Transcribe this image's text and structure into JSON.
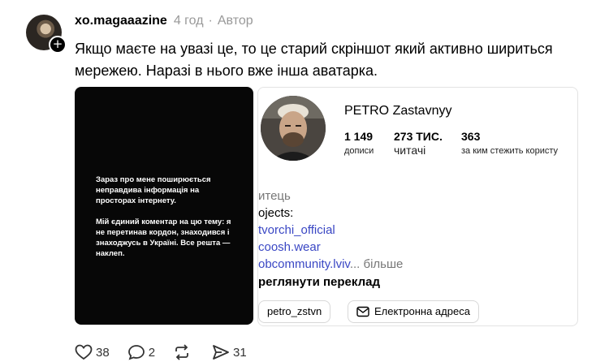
{
  "post": {
    "username": "xo.magaaazine",
    "time": "4 год",
    "role": "Автор",
    "separator": "·",
    "text": "Якщо маєте на увазі це, то це старий скріншот який активно шириться мережею. Наразі в нього вже інша аватарка."
  },
  "media_dark": {
    "paragraph_1": "Зараз про мене поширюється неправдива інформація на просторах інтернету.",
    "paragraph_2": "Мій єдиний коментар на цю тему: я не перетинав кордон, знаходився і знаходжусь в Україні. Все решта — наклеп."
  },
  "profile": {
    "name": "PETRO Zastavnyy",
    "stats": [
      {
        "num": "1 149",
        "label": "дописи"
      },
      {
        "num": "273 ТИС.",
        "label": "читачі"
      },
      {
        "num": "363",
        "label": "за ким стежить користу"
      }
    ],
    "category": "итець",
    "projects_label": "ojects:",
    "links": [
      "tvorchi_official",
      "coosh.wear",
      "obcommunity.lviv"
    ],
    "more_ellipsis": "...",
    "more": "більше",
    "translate": "реглянути переклад",
    "handle_pill": "petro_zstvn",
    "email_pill": "Електронна адреса"
  },
  "actions": {
    "likes": "38",
    "comments": "2",
    "reposts": "",
    "shares": "31"
  },
  "colors": {
    "link": "#3a47c4",
    "muted": "#999999"
  }
}
